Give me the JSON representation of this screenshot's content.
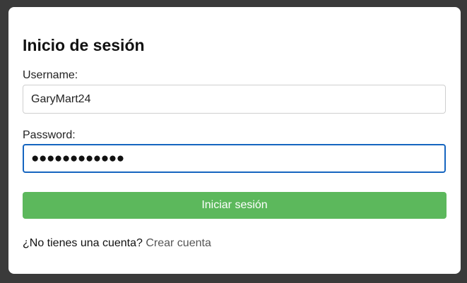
{
  "login": {
    "title": "Inicio de sesión",
    "username_label": "Username:",
    "username_value": "GaryMart24",
    "password_label": "Password:",
    "password_value_masked": "●●●●●●●●●●●●",
    "submit_label": "Iniciar sesión",
    "signup_prompt": "¿No tienes una cuenta?",
    "signup_link": "Crear cuenta"
  },
  "colors": {
    "background": "#3a3a3a",
    "card": "#ffffff",
    "button": "#5cb85c",
    "focus_border": "#1565c0",
    "link": "#555555"
  }
}
